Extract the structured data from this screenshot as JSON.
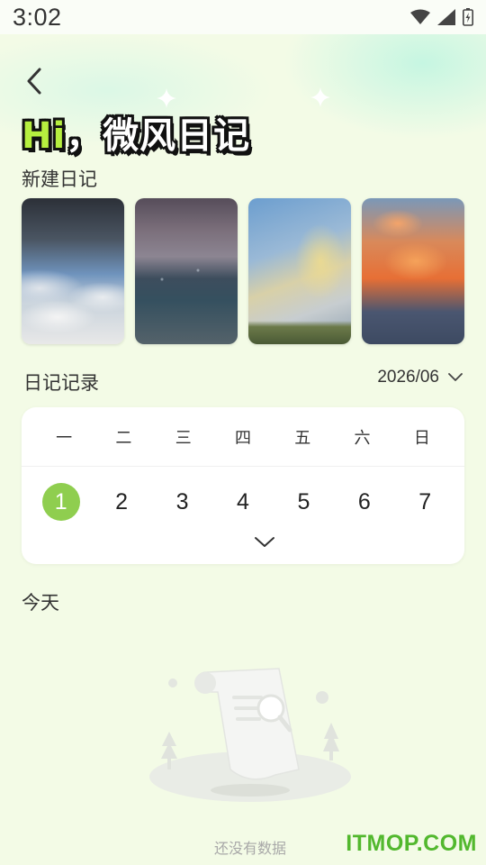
{
  "status_bar": {
    "time": "3:02"
  },
  "header": {
    "title_hi": "Hi",
    "title_rest": "，微风日记"
  },
  "new_diary": {
    "label": "新建日记",
    "cards": [
      {
        "name": "storm-clouds"
      },
      {
        "name": "rain-drops"
      },
      {
        "name": "rainbow-sky"
      },
      {
        "name": "sunset-clouds"
      }
    ]
  },
  "diary_records": {
    "label": "日记记录",
    "month": "2026/06",
    "weekdays": [
      "一",
      "二",
      "三",
      "四",
      "五",
      "六",
      "日"
    ],
    "days": [
      "1",
      "2",
      "3",
      "4",
      "5",
      "6",
      "7"
    ],
    "selected_day": "1"
  },
  "today": {
    "label": "今天",
    "empty_text": "还没有数据"
  },
  "watermark": "ITMOP.COM",
  "colors": {
    "accent": "#8fce4f",
    "background": "#f3fbe6",
    "watermark": "#52b82e"
  }
}
